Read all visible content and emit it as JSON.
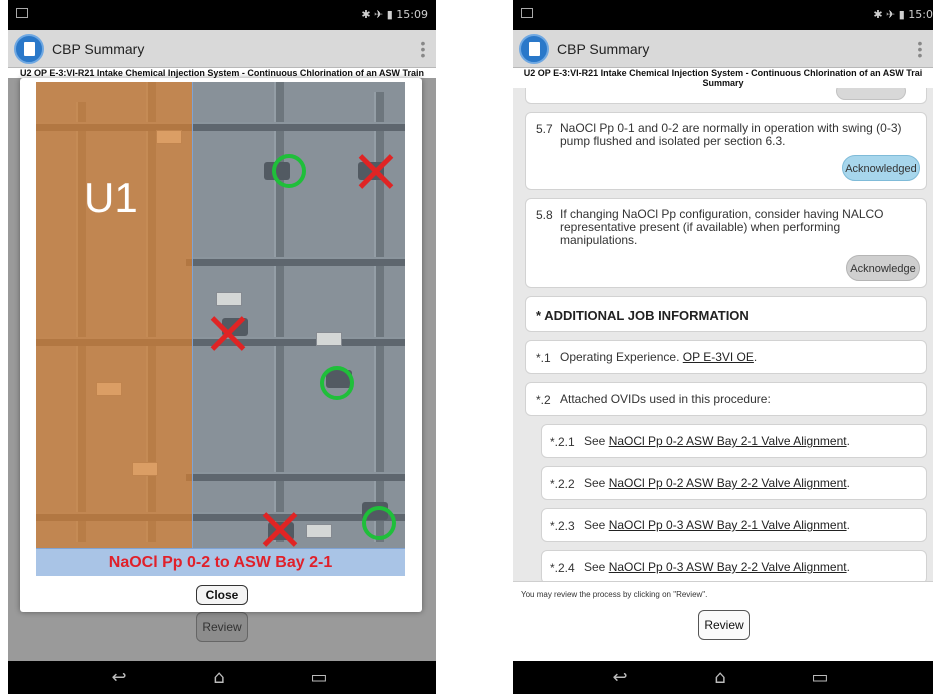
{
  "left": {
    "status_time": "15:09",
    "app_title": "CBP Summary",
    "procedure_title": "U2 OP E-3:VI-R21 Intake Chemical Injection System - Continuous Chlorination of an ASW Train",
    "photo_unit_label": "U1",
    "photo_caption": "NaOCl Pp 0-2 to ASW Bay 2-1",
    "close_label": "Close",
    "review_label": "Review"
  },
  "right": {
    "status_time": "15:0",
    "app_title": "CBP Summary",
    "procedure_title": "U2 OP E-3:VI-R21 Intake Chemical Injection System - Continuous Chlorination of an ASW Trai",
    "procedure_subtitle": "Summary",
    "steps": [
      {
        "num": "5.7",
        "text": "NaOCl Pp 0-1 and 0-2 are normally in operation with swing (0-3) pump flushed and isolated per section 6.3.",
        "ack_label": "Acknowledged"
      },
      {
        "num": "5.8",
        "text": "If changing NaOCl Pp configuration, consider having NALCO representative present (if available) when performing manipulations.",
        "ack_label": "Acknowledge"
      }
    ],
    "section_header": "* ADDITIONAL JOB INFORMATION",
    "info_items": [
      {
        "num": "*.1",
        "text": "Operating Experience. ",
        "link": "OP E-3VI OE",
        "suffix": "."
      },
      {
        "num": "*.2",
        "text": "Attached OVIDs used in this procedure:",
        "link": "",
        "suffix": ""
      }
    ],
    "ovids": [
      {
        "num": "*.2.1",
        "prefix": "See ",
        "link": "NaOCl Pp 0-2 ASW Bay 2-1 Valve Alignment",
        "suffix": "."
      },
      {
        "num": "*.2.2",
        "prefix": "See ",
        "link": "NaOCl Pp 0-2 ASW Bay 2-2 Valve Alignment",
        "suffix": "."
      },
      {
        "num": "*.2.3",
        "prefix": "See ",
        "link": "NaOCl Pp 0-3 ASW Bay 2-1 Valve Alignment",
        "suffix": "."
      },
      {
        "num": "*.2.4",
        "prefix": "See ",
        "link": "NaOCl Pp 0-3 ASW Bay 2-2 Valve Alignment",
        "suffix": "."
      }
    ],
    "review_note": "You may review the process by clicking on \"Review\".",
    "review_label": "Review"
  },
  "icons": {
    "status_left": "notification-icon",
    "status_right": "bluetooth-airplane-battery-icons",
    "app": "document-app-icon",
    "overflow": "overflow-menu-icon",
    "nav_back": "back-icon",
    "nav_home": "home-icon",
    "nav_recents": "recents-icon"
  },
  "colors": {
    "acknowledged_bg": "#a7d6ec",
    "acknowledge_bg": "#cfcfcf",
    "caption_text": "#e0202a",
    "keep_mark": "#1fbf3a",
    "closed_mark": "#e02424"
  }
}
